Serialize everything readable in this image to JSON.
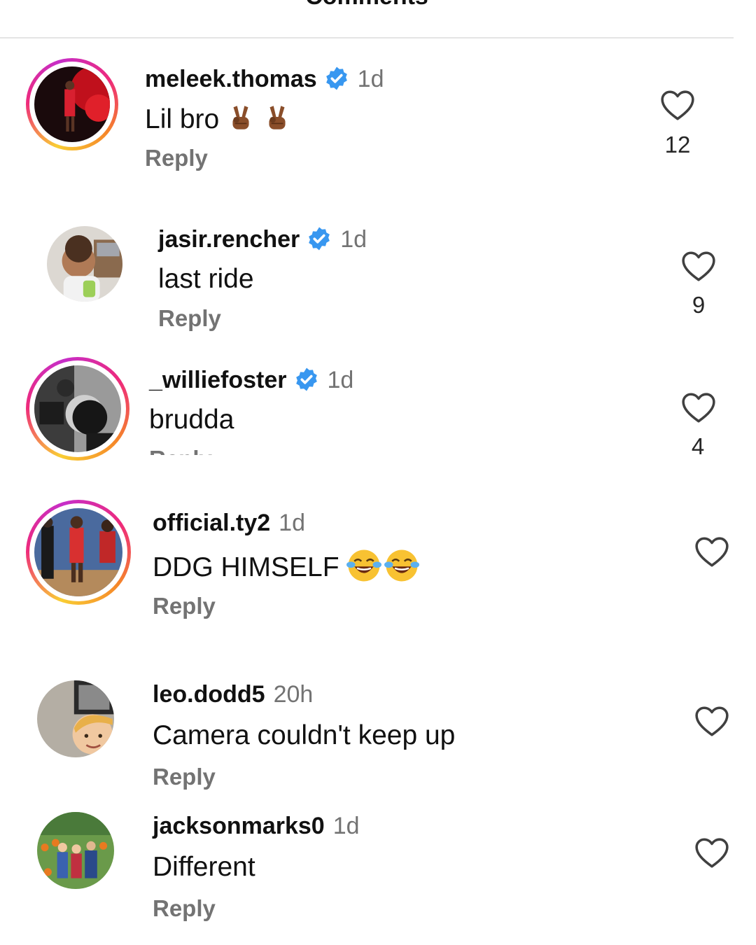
{
  "header": {
    "title": "Comments"
  },
  "comments": [
    {
      "username": "meleek.thomas",
      "verified": true,
      "time": "1d",
      "text": "Lil bro",
      "emojis": [
        "victory-hand-dark-skin-icon",
        "victory-hand-dark-skin-icon"
      ],
      "reply_label": "Reply",
      "likes": "12",
      "story_ring": true
    },
    {
      "username": "jasir.rencher",
      "verified": true,
      "time": "1d",
      "text": "last ride",
      "emojis": [],
      "reply_label": "Reply",
      "likes": "9",
      "story_ring": false
    },
    {
      "username": "_williefoster",
      "verified": true,
      "time": "1d",
      "text": "brudda",
      "emojis": [],
      "reply_label": "Reply",
      "likes": "4",
      "story_ring": true
    },
    {
      "username": "official.ty2",
      "verified": false,
      "time": "1d",
      "text": "DDG HIMSELF",
      "emojis": [
        "face-with-tears-of-joy-icon",
        "face-with-tears-of-joy-icon"
      ],
      "reply_label": "Reply",
      "likes": "",
      "story_ring": true
    },
    {
      "username": "leo.dodd5",
      "verified": false,
      "time": "20h",
      "text": "Camera couldn't keep up",
      "emojis": [],
      "reply_label": "Reply",
      "likes": "",
      "story_ring": false
    },
    {
      "username": "jacksonmarks0",
      "verified": false,
      "time": "1d",
      "text": "Different",
      "emojis": [],
      "reply_label": "Reply",
      "likes": "",
      "story_ring": false
    }
  ],
  "colors": {
    "verified_badge": "#3897f0",
    "muted_text": "#737373",
    "story_ring_start": "#f9ce34",
    "story_ring_end": "#c62ec9"
  }
}
